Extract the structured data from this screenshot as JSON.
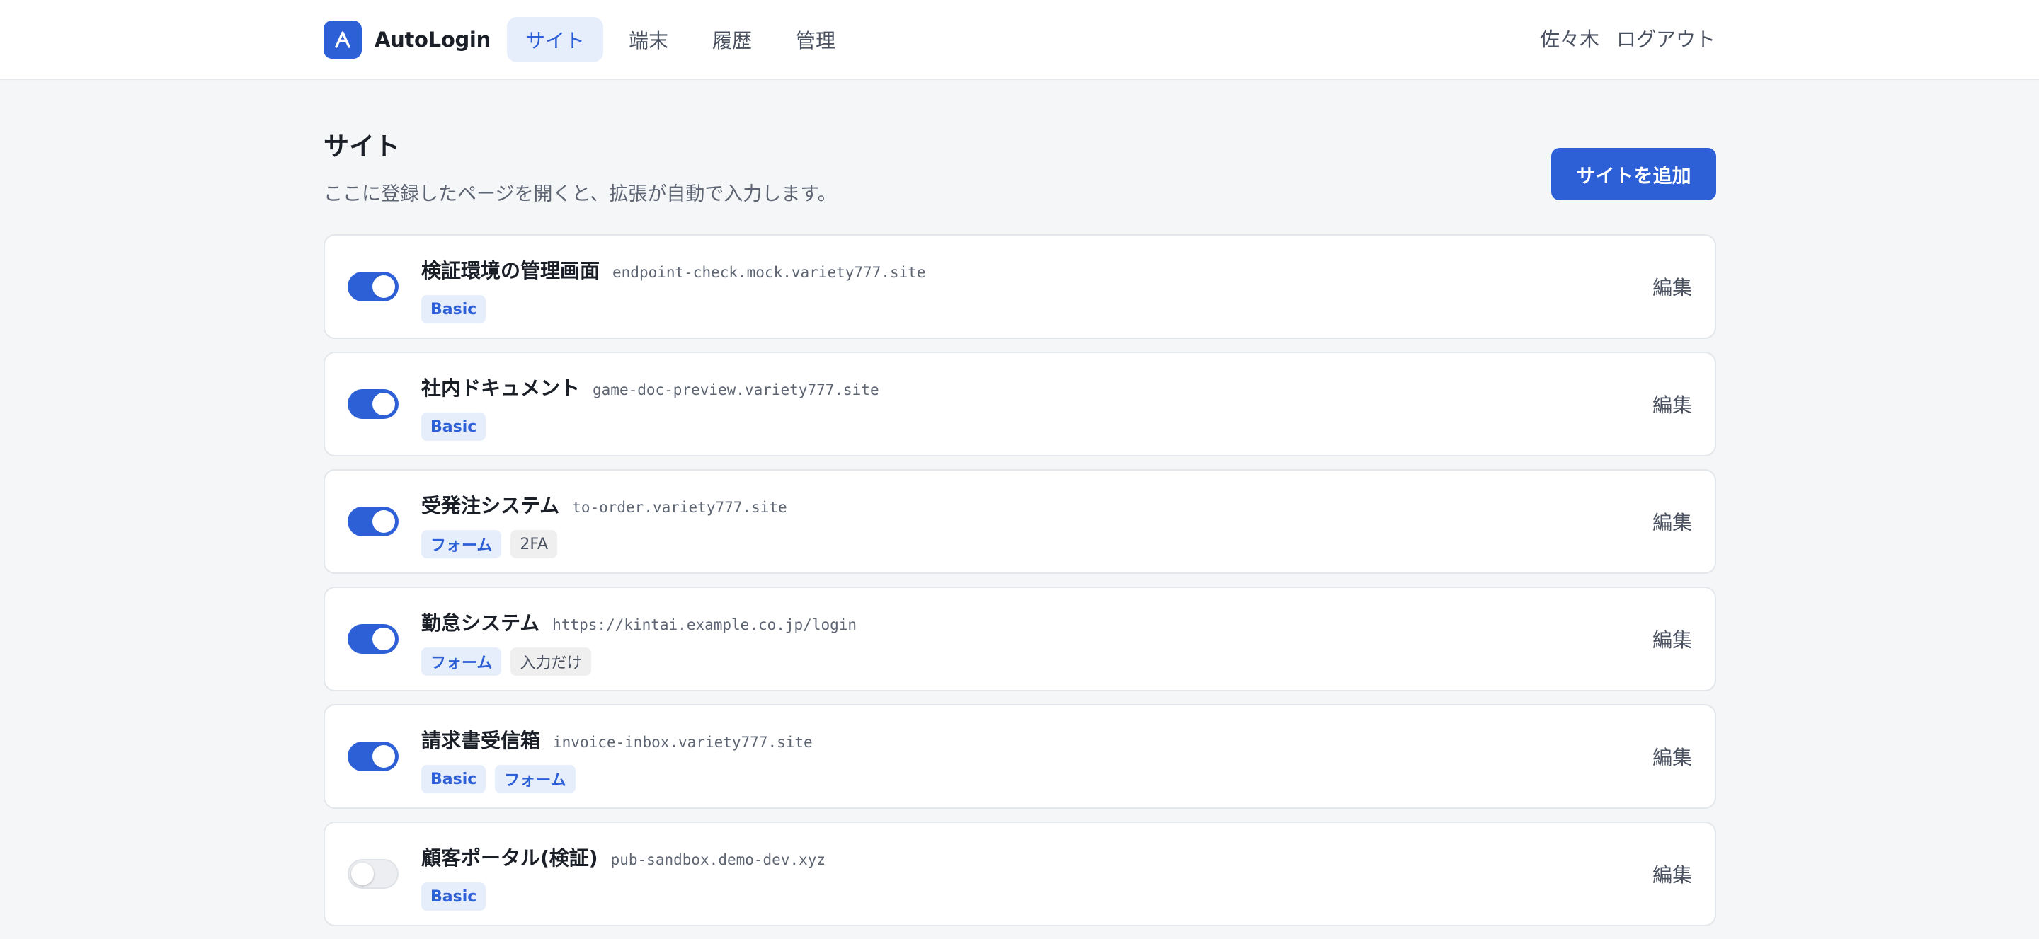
{
  "app": {
    "name": "AutoLogin"
  },
  "nav": [
    {
      "label": "サイト",
      "active": true
    },
    {
      "label": "端末",
      "active": false
    },
    {
      "label": "履歴",
      "active": false
    },
    {
      "label": "管理",
      "active": false
    }
  ],
  "user": {
    "name": "佐々木",
    "logout_label": "ログアウト"
  },
  "page": {
    "title": "サイト",
    "subtitle": "ここに登録したページを開くと、拡張が自動で入力します。",
    "add_button_label": "サイトを追加"
  },
  "sites": [
    {
      "name": "検証環境の管理画面",
      "domain": "endpoint-check.mock.variety777.site",
      "enabled": true,
      "tags": [
        {
          "label": "Basic",
          "style": "blue"
        }
      ],
      "edit_label": "編集"
    },
    {
      "name": "社内ドキュメント",
      "domain": "game-doc-preview.variety777.site",
      "enabled": true,
      "tags": [
        {
          "label": "Basic",
          "style": "blue"
        }
      ],
      "edit_label": "編集"
    },
    {
      "name": "受発注システム",
      "domain": "to-order.variety777.site",
      "enabled": true,
      "tags": [
        {
          "label": "フォーム",
          "style": "blue"
        },
        {
          "label": "2FA",
          "style": "gray"
        }
      ],
      "edit_label": "編集"
    },
    {
      "name": "勤怠システム",
      "domain": "https://kintai.example.co.jp/login",
      "enabled": true,
      "tags": [
        {
          "label": "フォーム",
          "style": "blue"
        },
        {
          "label": "入力だけ",
          "style": "gray"
        }
      ],
      "edit_label": "編集"
    },
    {
      "name": "請求書受信箱",
      "domain": "invoice-inbox.variety777.site",
      "enabled": true,
      "tags": [
        {
          "label": "Basic",
          "style": "blue"
        },
        {
          "label": "フォーム",
          "style": "blue"
        }
      ],
      "edit_label": "編集"
    },
    {
      "name": "顧客ポータル(検証)",
      "domain": "pub-sandbox.demo-dev.xyz",
      "enabled": false,
      "tags": [
        {
          "label": "Basic",
          "style": "blue"
        }
      ],
      "edit_label": "編集"
    }
  ]
}
